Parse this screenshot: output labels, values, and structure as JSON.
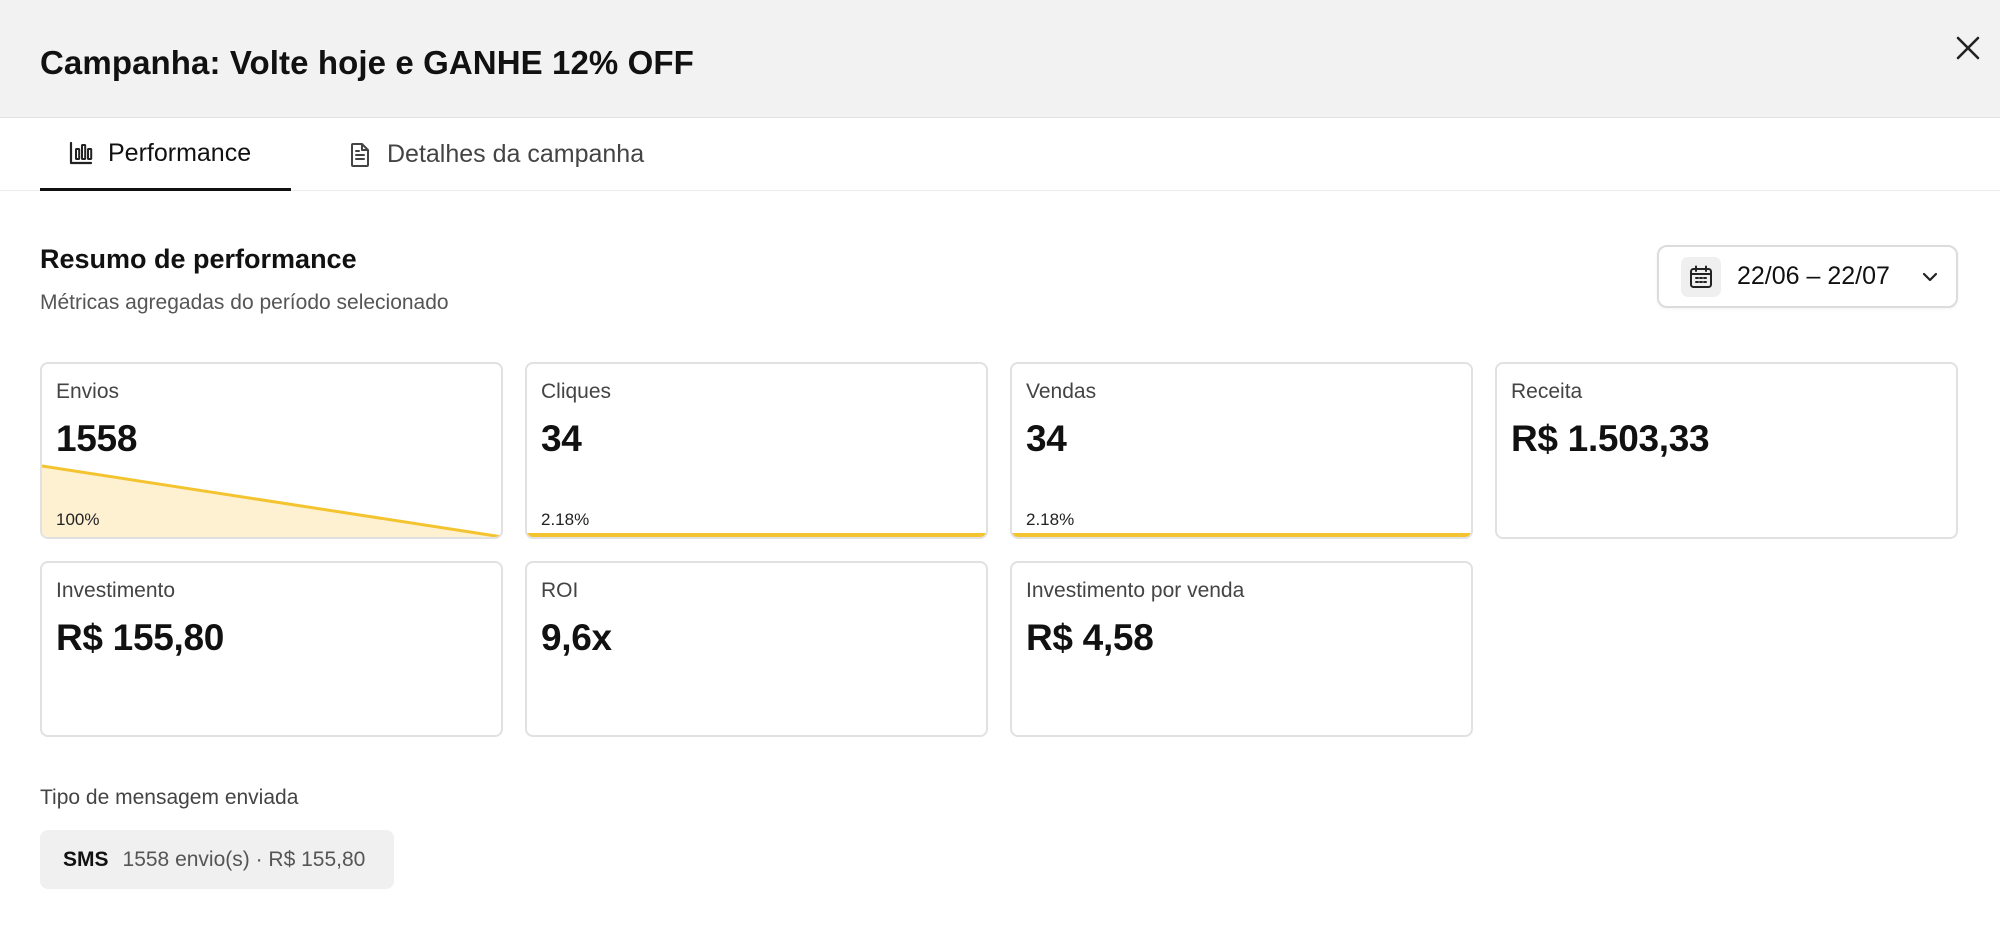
{
  "header": {
    "title": "Campanha: Volte hoje e GANHE 12% OFF"
  },
  "tabs": [
    {
      "label": "Performance",
      "icon": "bar-chart-icon",
      "active": true
    },
    {
      "label": "Detalhes da campanha",
      "icon": "document-icon",
      "active": false
    }
  ],
  "summary": {
    "title": "Resumo de performance",
    "subtitle": "Métricas agregadas do período selecionado",
    "date_range": "22/06 – 22/07"
  },
  "metrics": [
    {
      "label": "Envios",
      "value": "1558",
      "pct": "100%",
      "funnel_start": 1.0,
      "funnel_end": 0.0218
    },
    {
      "label": "Cliques",
      "value": "34",
      "pct": "2.18%",
      "funnel_start": 0.0218,
      "funnel_end": 0.0218
    },
    {
      "label": "Vendas",
      "value": "34",
      "pct": "2.18%",
      "funnel_start": 0.0218,
      "funnel_end": 0.0218
    },
    {
      "label": "Receita",
      "value": "R$ 1.503,33"
    },
    {
      "label": "Investimento",
      "value": "R$ 155,80"
    },
    {
      "label": "ROI",
      "value": "9,6x"
    },
    {
      "label": "Investimento por venda",
      "value": "R$ 4,58"
    }
  ],
  "messages": {
    "label": "Tipo de mensagem enviada",
    "items": [
      {
        "type": "SMS",
        "detail": "1558 envio(s) · R$ 155,80"
      }
    ]
  },
  "colors": {
    "accent": "#f4c430",
    "accent_fill": "#fdf1d2",
    "header_bg": "#f2f2f2"
  }
}
